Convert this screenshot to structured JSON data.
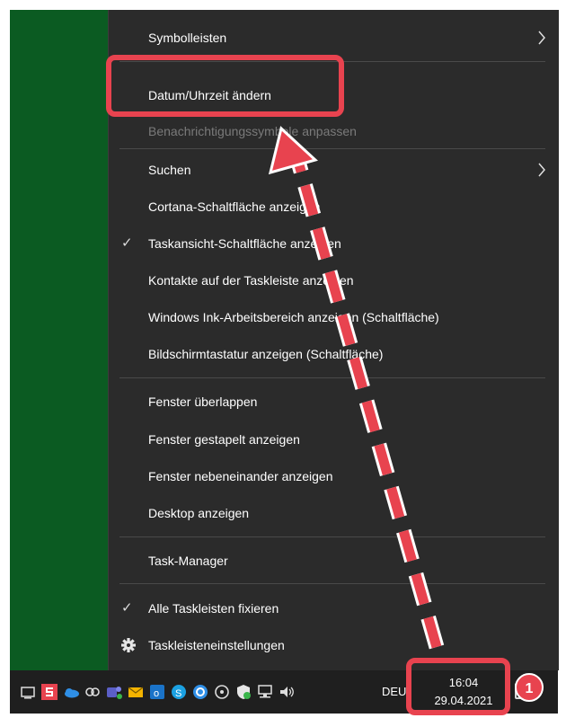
{
  "context_menu": {
    "items": [
      {
        "label": "Symbolleisten",
        "submenu": true
      },
      {
        "label": "Datum/Uhrzeit ändern"
      },
      {
        "label": "Benachrichtigungssymbole anpassen",
        "disabled": true
      },
      {
        "label": "Suchen",
        "submenu": true
      },
      {
        "label": "Cortana-Schaltfläche anzeigen"
      },
      {
        "label": "Taskansicht-Schaltfläche anzeigen",
        "checked": true
      },
      {
        "label": "Kontakte auf der Taskleiste anzeigen"
      },
      {
        "label": "Windows Ink-Arbeitsbereich anzeigen (Schaltfläche)"
      },
      {
        "label": "Bildschirmtastatur anzeigen (Schaltfläche)"
      },
      {
        "label": "Fenster überlappen"
      },
      {
        "label": "Fenster gestapelt anzeigen"
      },
      {
        "label": "Fenster nebeneinander anzeigen"
      },
      {
        "label": "Desktop anzeigen"
      },
      {
        "label": "Task-Manager"
      },
      {
        "label": "Alle Taskleisten fixieren",
        "checked": true
      },
      {
        "label": "Taskleisteneinstellungen",
        "icon": "gear-icon"
      }
    ],
    "check_glyph": "✓",
    "chevron_glyph": "›"
  },
  "taskbar": {
    "language": "DEU",
    "time": "16:04",
    "date": "29.04.2021",
    "tray_icons": [
      "show-hidden-icon",
      "app-s-icon",
      "onedrive-icon",
      "link-icon",
      "teams-icon",
      "mail-icon",
      "outlook-icon",
      "skype-icon",
      "sync-icon",
      "chat-icon",
      "security-shield-icon",
      "network-icon",
      "speaker-icon"
    ]
  },
  "annotation": {
    "badge_number": "1",
    "color": "#e8434f"
  },
  "colors": {
    "menu_bg": "#2b2b2b",
    "desktop": "#0b5b22",
    "taskbar": "#1f1f1f"
  }
}
